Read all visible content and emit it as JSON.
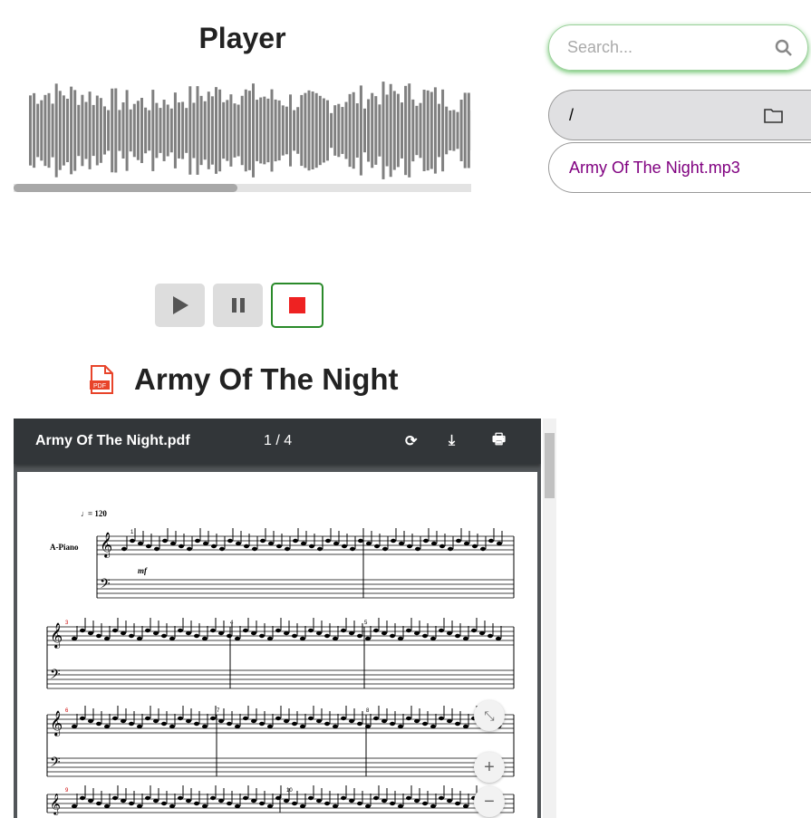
{
  "player": {
    "title": "Player",
    "progress": 0.49
  },
  "controls": {
    "play": "play-icon",
    "pause": "pause-icon",
    "stop": "stop-icon",
    "stop_color": "#ee2222"
  },
  "song": {
    "title": "Army Of The Night",
    "icon": "pdf-icon"
  },
  "pdf": {
    "filename": "Army Of The Night.pdf",
    "page": "1 / 4",
    "score": {
      "tempo": "= 120",
      "instrument": "A-Piano",
      "dynamic": "mf",
      "measures": [
        "1",
        "3",
        "4",
        "5",
        "6",
        "7",
        "8",
        "9",
        "10"
      ]
    }
  },
  "search": {
    "placeholder": "Search...",
    "value": ""
  },
  "files": [
    {
      "name": "/",
      "icon": "folder-icon"
    },
    {
      "name": "Army Of The Night.mp3",
      "color": "#800080"
    }
  ]
}
